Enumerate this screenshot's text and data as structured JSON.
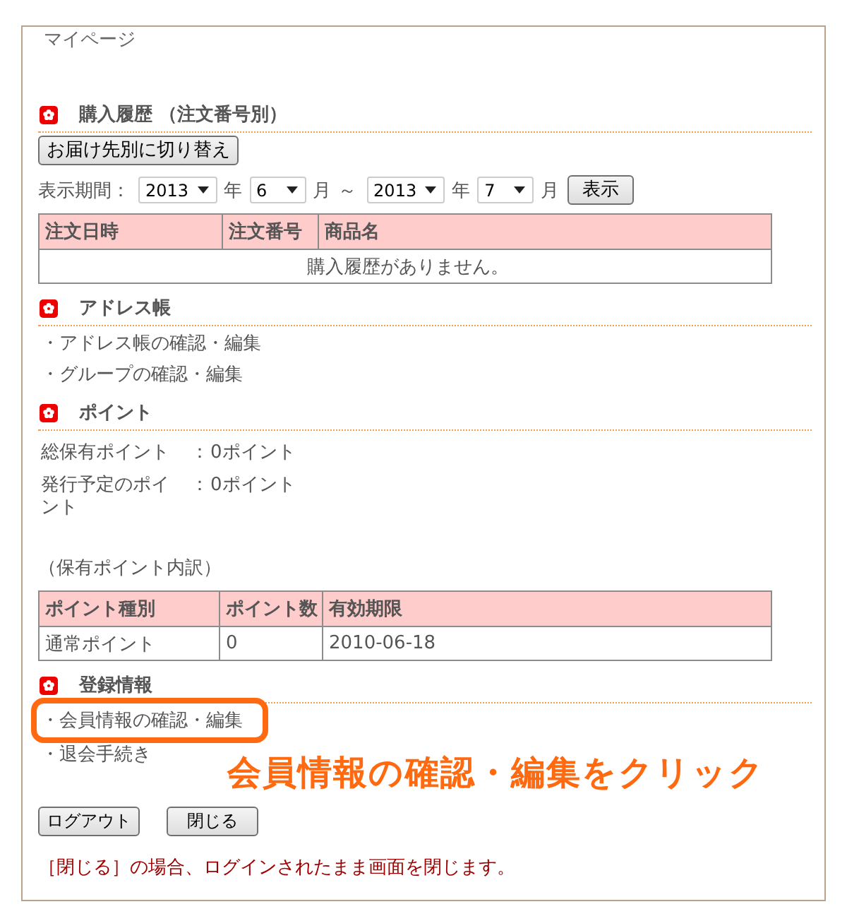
{
  "page_title": "マイページ",
  "purchase_history": {
    "heading": "購入履歴 （注文番号別）",
    "switch_button": "お届け先別に切り替え",
    "period": [
      {
        "kind": "label",
        "text": "表示期間："
      },
      {
        "kind": "select",
        "value": "2013"
      },
      {
        "kind": "unit",
        "text": "年"
      },
      {
        "kind": "select",
        "value": "6"
      },
      {
        "kind": "unit",
        "text": "月"
      },
      {
        "kind": "separator",
        "text": "～"
      },
      {
        "kind": "select",
        "value": "2013"
      },
      {
        "kind": "unit",
        "text": "年"
      },
      {
        "kind": "select",
        "value": "7"
      },
      {
        "kind": "unit",
        "text": "月"
      },
      {
        "kind": "button",
        "text": "表示"
      }
    ],
    "table": {
      "columns": [
        "注文日時",
        "注文番号",
        "商品名"
      ],
      "empty_message": "購入履歴がありません。"
    }
  },
  "address_book": {
    "heading": "アドレス帳",
    "links": [
      "・アドレス帳の確認・編集",
      "・グループの確認・編集"
    ]
  },
  "points": {
    "heading": "ポイント",
    "summary": [
      {
        "label": "総保有ポイント",
        "separator": "：",
        "value": "0ポイント"
      },
      {
        "label": "発行予定のポイント",
        "separator": "：",
        "value": "0ポイント"
      }
    ],
    "breakdown_title": "（保有ポイント内訳）",
    "table": {
      "columns": [
        "ポイント種別",
        "ポイント数",
        "有効期限"
      ],
      "rows": [
        [
          "通常ポイント",
          "0",
          "2010-06-18"
        ]
      ]
    }
  },
  "registration": {
    "heading": "登録情報",
    "links": [
      {
        "text": "・会員情報の確認・編集",
        "highlighted": true
      },
      {
        "text": "・退会手続き",
        "highlighted": false
      }
    ]
  },
  "buttons": [
    {
      "label": "ログアウト"
    },
    {
      "label": "閉じる"
    }
  ],
  "note": "［閉じる］の場合、ログインされたまま画面を閉じます。",
  "callout": {
    "text": "会員情報の確認・編集をクリック"
  }
}
